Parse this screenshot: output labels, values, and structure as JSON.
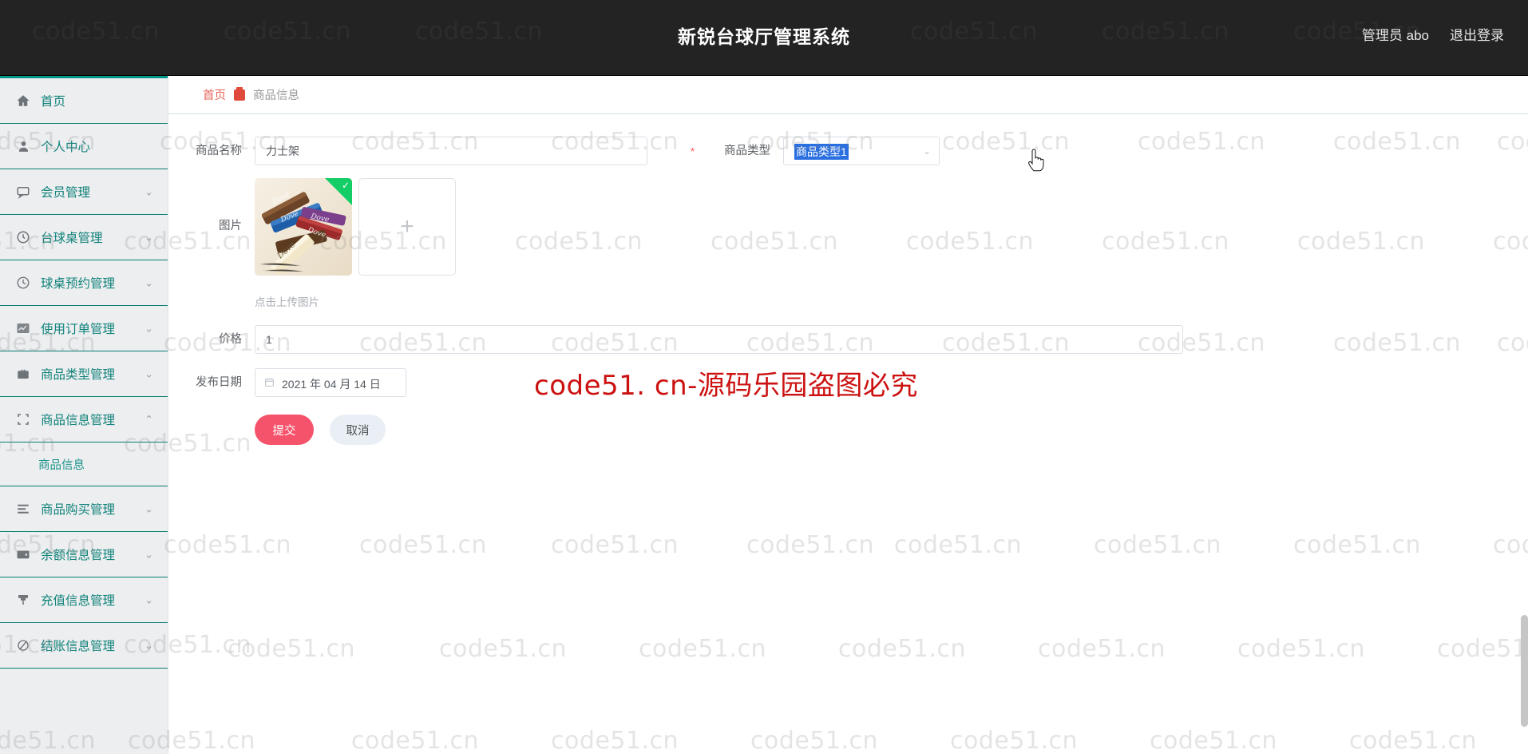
{
  "header": {
    "title": "新锐台球厅管理系统",
    "user_label": "管理员 abo",
    "logout_label": "退出登录",
    "bg_color": "#232323"
  },
  "sidebar": {
    "accent_color": "#009688",
    "items": [
      {
        "label": "首页",
        "icon": "home-icon",
        "expandable": false,
        "active": true
      },
      {
        "label": "个人中心",
        "icon": "user-icon",
        "expandable": false
      },
      {
        "label": "会员管理",
        "icon": "comment-icon",
        "expandable": true,
        "chevron": "down"
      },
      {
        "label": "台球桌管理",
        "icon": "clock-circle-icon",
        "expandable": true,
        "chevron": "down"
      },
      {
        "label": "球桌预约管理",
        "icon": "time-icon",
        "expandable": true,
        "chevron": "down"
      },
      {
        "label": "使用订单管理",
        "icon": "chart-icon",
        "expandable": true,
        "chevron": "down"
      },
      {
        "label": "商品类型管理",
        "icon": "briefcase-icon",
        "expandable": true,
        "chevron": "down"
      },
      {
        "label": "商品信息管理",
        "icon": "frame-icon",
        "expandable": true,
        "chevron": "up",
        "expanded": true
      },
      {
        "label": "商品购买管理",
        "icon": "list-icon",
        "expandable": true,
        "chevron": "down"
      },
      {
        "label": "余额信息管理",
        "icon": "wallet-icon",
        "expandable": true,
        "chevron": "down"
      },
      {
        "label": "充值信息管理",
        "icon": "pin-icon",
        "expandable": true,
        "chevron": "down"
      },
      {
        "label": "结账信息管理",
        "icon": "slash-circle-icon",
        "expandable": true,
        "chevron": "down"
      }
    ],
    "submenu": {
      "label": "商品信息",
      "parent": "商品信息管理"
    }
  },
  "breadcrumb": {
    "home": "首页",
    "current": "商品信息",
    "separator_icon": "shop-icon"
  },
  "form": {
    "name": {
      "label": "商品名称",
      "required": true,
      "value": "力士架",
      "placeholder": "商品名称"
    },
    "type": {
      "label": "商品类型",
      "required": true,
      "value": "商品类型1",
      "selected_highlight": "#2a6fe0",
      "arrow_icon": "chevron-down-icon"
    },
    "image": {
      "label": "图片",
      "upload_hint": "点击上传图片",
      "add_icon": "plus-icon",
      "uploaded_badge_icon": "check-icon",
      "uploaded_count": 1
    },
    "price": {
      "label": "价格",
      "required": true,
      "value": "1",
      "placeholder": "价格"
    },
    "date": {
      "label": "发布日期",
      "required": false,
      "value": "2021 年 04 月 14 日",
      "icon": "calendar-icon"
    },
    "submit_label": "提交",
    "cancel_label": "取消"
  },
  "watermark": {
    "tile_text": "code51.cn",
    "stamp_text": "code51. cn-源码乐园盗图必究",
    "stamp_color": "#cc1111"
  }
}
